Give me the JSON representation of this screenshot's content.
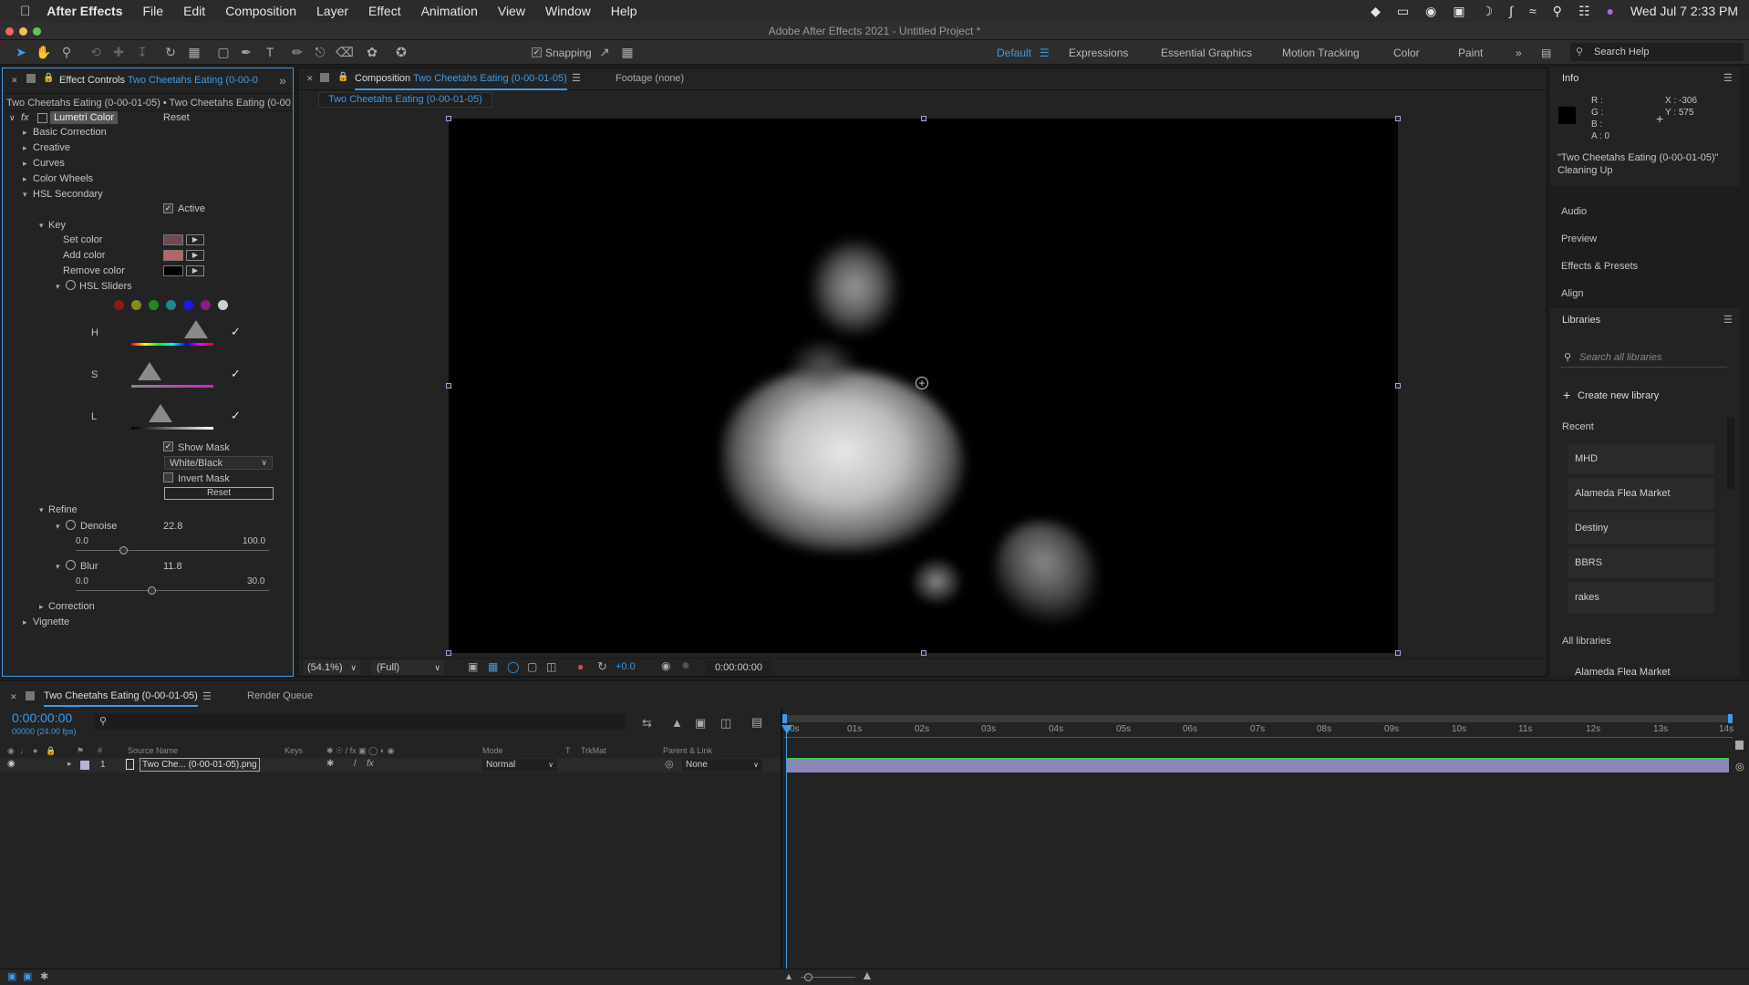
{
  "menubar": {
    "app": "After Effects",
    "items": [
      "File",
      "Edit",
      "Composition",
      "Layer",
      "Effect",
      "Animation",
      "View",
      "Window",
      "Help"
    ],
    "clock": "Wed Jul 7  2:33 PM"
  },
  "window_title": "Adobe After Effects 2021 - Untitled Project *",
  "toolbar": {
    "snapping_label": "Snapping",
    "workspaces": [
      "Default",
      "Expressions",
      "Essential Graphics",
      "Motion Tracking",
      "Color",
      "Paint"
    ],
    "search_placeholder": "Search Help"
  },
  "effect_controls": {
    "tab_label": "Effect Controls",
    "tab_item": "Two Cheetahs Eating (0-00-0",
    "breadcrumb": "Two Cheetahs Eating (0-00-01-05) • Two Cheetahs Eating (0-00-(",
    "fx_label": "fx",
    "effect_name": "Lumetri Color",
    "reset_label": "Reset",
    "sections": [
      "Basic Correction",
      "Creative",
      "Curves",
      "Color Wheels",
      "HSL Secondary"
    ],
    "active_label": "Active",
    "key_label": "Key",
    "set_color": "Set color",
    "add_color": "Add color",
    "remove_color": "Remove color",
    "hsl_sliders": "HSL Sliders",
    "h": "H",
    "s": "S",
    "l": "L",
    "show_mask": "Show Mask",
    "mask_mode": "White/Black",
    "invert_mask": "Invert Mask",
    "reset_button": "Reset",
    "refine": "Refine",
    "denoise": "Denoise",
    "denoise_value": "22.8",
    "denoise_min": "0.0",
    "denoise_max": "100.0",
    "blur": "Blur",
    "blur_value": "11.8",
    "blur_min": "0.0",
    "blur_max": "30.0",
    "correction": "Correction",
    "vignette": "Vignette"
  },
  "composition": {
    "tab_label": "Composition",
    "tab_item": "Two Cheetahs Eating (0-00-01-05)",
    "footage_tab": "Footage (none)",
    "sub_tab": "Two Cheetahs Eating (0-00-01-05)",
    "zoom": "(54.1%)",
    "resolution": "(Full)",
    "exposure": "+0.0",
    "timecode": "0:00:00:00"
  },
  "info": {
    "title": "Info",
    "r": "R :",
    "g": "G :",
    "b": "B :",
    "a": "A :  0",
    "x": "X : -306",
    "y": "Y :  575",
    "line1": "\"Two Cheetahs Eating (0-00-01-05)\"",
    "line2": "Cleaning Up"
  },
  "side_panels": [
    "Audio",
    "Preview",
    "Effects & Presets",
    "Align"
  ],
  "libraries": {
    "title": "Libraries",
    "search_placeholder": "Search all libraries",
    "create": "Create new library",
    "recent_label": "Recent",
    "recent": [
      "MHD",
      "Alameda Flea Market",
      "Destiny",
      "BBRS",
      "rakes"
    ],
    "all_label": "All libraries",
    "all_first": "Alameda Flea Market"
  },
  "timeline": {
    "tab_label": "Two Cheetahs Eating (0-00-01-05)",
    "render_queue": "Render Queue",
    "timecode": "0:00:00:00",
    "frames": "00000 (24.00 fps)",
    "columns": {
      "hash": "#",
      "source": "Source Name",
      "keys": "Keys",
      "mode": "Mode",
      "t": "T",
      "trkmat": "TrkMat",
      "parent": "Parent & Link"
    },
    "layer_num": "1",
    "layer_name": "Two Che... (0-00-01-05).png",
    "layer_mode": "Normal",
    "layer_parent": "None",
    "ticks": [
      "0s",
      "01s",
      "02s",
      "03s",
      "04s",
      "05s",
      "06s",
      "07s",
      "08s",
      "09s",
      "10s",
      "11s",
      "12s",
      "13s",
      "14s"
    ]
  },
  "colors": {
    "accent": "#3d9bea",
    "set_color_swatch": "#6b4a52",
    "add_color_swatch": "#b86466",
    "remove_color_swatch": "#000000",
    "layer_bar": "#8a87b8"
  }
}
